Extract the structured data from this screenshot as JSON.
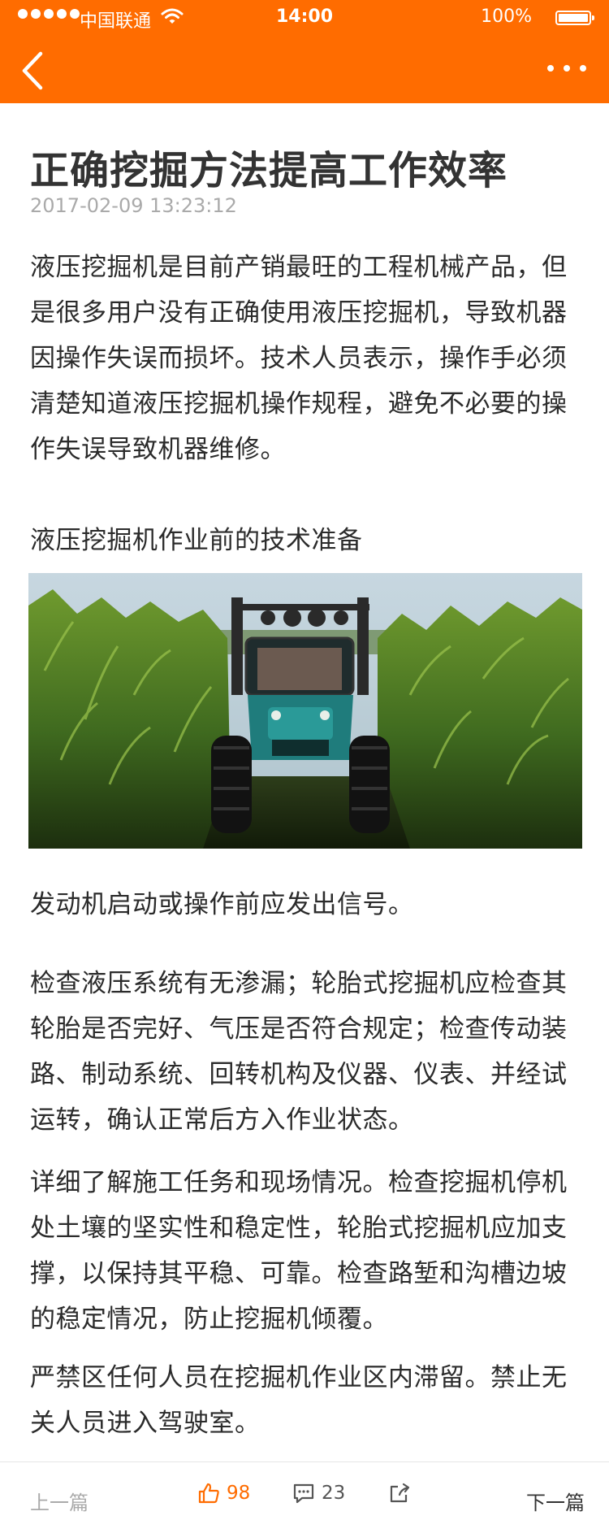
{
  "status_bar": {
    "carrier": "中国联通",
    "time": "14:00",
    "battery": "100%",
    "icons": [
      "signal-dots-icon",
      "wifi-icon",
      "battery-icon"
    ]
  },
  "nav": {
    "back_icon": "chevron-left-icon",
    "more_icon": "more-horizontal-icon",
    "background_color": "#ff6c00"
  },
  "article": {
    "title": "正确挖掘方法提高工作效率",
    "date": "2017-02-09 13:23:12",
    "paragraphs": [
      "液压挖掘机是目前产销最旺的工程机械产品，但是很多用户没有正确使用液压挖掘机，导致机器因操作失误而损坏。技术人员表示，操作手必须清楚知道液压挖掘机操作规程，避免不必要的操作失误导致机器维修。",
      "液压挖掘机作业前的技术准备",
      "发动机启动或操作前应发出信号。",
      "检查液压系统有无渗漏；轮胎式挖掘机应检查其轮胎是否完好、气压是否符合规定；检查传动装路、制动系统、回转机构及仪器、仪表、并经试运转，确认正常后方入作业状态。",
      "详细了解施工任务和现场情况。检查挖掘机停机处土壤的坚实性和稳定性，轮胎式挖掘机应加支撑，以保持其平稳、可靠。检查路堑和沟槽边坡的稳定情况，防止挖掘机倾覆。",
      "严禁区任何人员在挖掘机作业区内滞留。禁止无关人员进入驾驶室。"
    ],
    "image": "tractor-in-cornfield-photo"
  },
  "footer": {
    "prev": "上一篇",
    "next": "下一篇",
    "likes": "98",
    "comments": "23",
    "like_icon": "thumbs-up-icon",
    "comment_icon": "comment-icon",
    "share_icon": "share-icon",
    "accent_color": "#ff6c00"
  }
}
